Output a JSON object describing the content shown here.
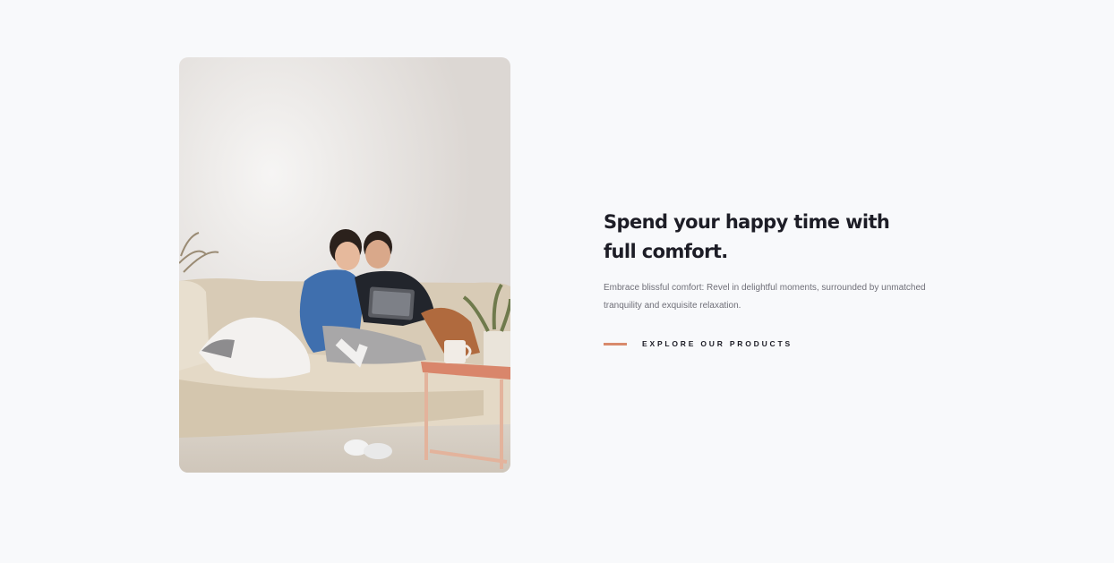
{
  "feature": {
    "heading": "Spend your happy time with full comfort.",
    "description": "Embrace blissful comfort: Revel in delightful moments, surrounded by unmatched tranquility and exquisite relaxation.",
    "cta_label": "EXPLORE OUR PRODUCTS"
  },
  "colors": {
    "background": "#f8f9fb",
    "heading": "#1d1d26",
    "body_text": "#6f6f78",
    "accent": "#d88a6c"
  }
}
